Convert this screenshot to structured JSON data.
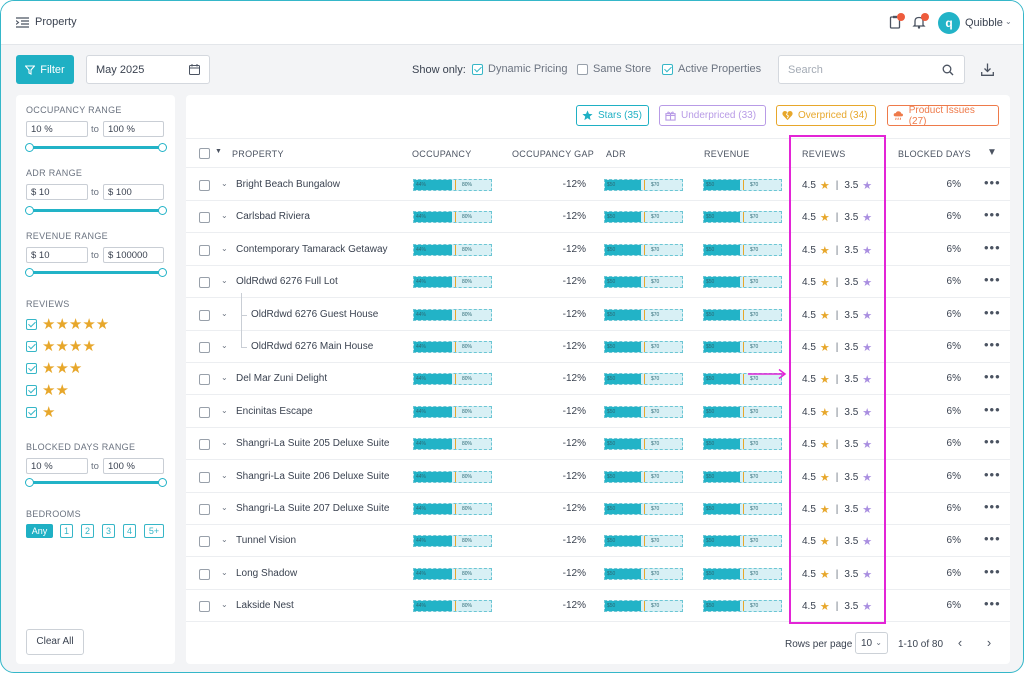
{
  "header": {
    "title": "Property",
    "user_initial": "q",
    "user_name": "Quibble",
    "icons": [
      "menu-collapse-icon",
      "clipboard-icon",
      "bell-icon",
      "chevron-down-icon"
    ]
  },
  "toolbar": {
    "filter_label": "Filter",
    "date": "May 2025",
    "show_only_label": "Show only:",
    "options": [
      {
        "label": "Dynamic Pricing",
        "checked": true
      },
      {
        "label": "Same Store",
        "checked": false
      },
      {
        "label": "Active Properties",
        "checked": true
      }
    ],
    "search_placeholder": "Search"
  },
  "sidebar": {
    "occupancy": {
      "label": "OCCUPANCY RANGE",
      "min": "10 %",
      "to": "to",
      "max": "100 %"
    },
    "adr": {
      "label": "ADR RANGE",
      "min": "$ 10",
      "to": "to",
      "max": "$ 100"
    },
    "revenue": {
      "label": "REVENUE RANGE",
      "min": "$ 10",
      "to": "to",
      "max": "$ 100000"
    },
    "reviews_label": "REVIEWS",
    "review_stars": [
      "★★★★★",
      "★★★★",
      "★★★",
      "★★",
      "★"
    ],
    "blocked": {
      "label": "BLOCKED DAYS RANGE",
      "min": "10 %",
      "to": "to",
      "max": "100 %"
    },
    "bedrooms_label": "BEDROOMS",
    "bedrooms": [
      "Any",
      "1",
      "2",
      "3",
      "4",
      "5+"
    ],
    "clear_label": "Clear All"
  },
  "chips": [
    {
      "label": "Stars (35)",
      "color": "#1fb0c4"
    },
    {
      "label": "Underpriced (33)",
      "color": "#b89be6"
    },
    {
      "label": "Overpriced (34)",
      "color": "#e7a72b"
    },
    {
      "label": "Product Issues (27)",
      "color": "#ee7a4a"
    }
  ],
  "table": {
    "headers": {
      "property": "PROPERTY",
      "occupancy": "OCCUPANCY",
      "occupancy_gap": "OCCUPANCY GAP",
      "adr": "ADR",
      "revenue": "REVENUE",
      "reviews": "REVIEWS",
      "blocked_days": "BLOCKED DAYS"
    },
    "bar_labels": {
      "occ_a": "44%",
      "occ_b": "80%",
      "money_a": "$50",
      "money_b": "$70"
    },
    "rows": [
      {
        "name": "Bright Beach Bungalow",
        "gap": "-12%",
        "r1": "4.5",
        "r2": "3.5",
        "blocked": "6%",
        "child": false
      },
      {
        "name": "Carlsbad Riviera",
        "gap": "-12%",
        "r1": "4.5",
        "r2": "3.5",
        "blocked": "6%",
        "child": false
      },
      {
        "name": "Contemporary Tamarack Getaway",
        "gap": "-12%",
        "r1": "4.5",
        "r2": "3.5",
        "blocked": "6%",
        "child": false
      },
      {
        "name": "OldRdwd 6276 Full Lot",
        "gap": "-12%",
        "r1": "4.5",
        "r2": "3.5",
        "blocked": "6%",
        "child": false
      },
      {
        "name": "OldRdwd 6276 Guest House",
        "gap": "-12%",
        "r1": "4.5",
        "r2": "3.5",
        "blocked": "6%",
        "child": true
      },
      {
        "name": "OldRdwd 6276 Main House",
        "gap": "-12%",
        "r1": "4.5",
        "r2": "3.5",
        "blocked": "6%",
        "child": true
      },
      {
        "name": "Del Mar Zuni Delight",
        "gap": "-12%",
        "r1": "4.5",
        "r2": "3.5",
        "blocked": "6%",
        "child": false
      },
      {
        "name": "Encinitas Escape",
        "gap": "-12%",
        "r1": "4.5",
        "r2": "3.5",
        "blocked": "6%",
        "child": false
      },
      {
        "name": "Shangri-La Suite  205 Deluxe Suite",
        "gap": "-12%",
        "r1": "4.5",
        "r2": "3.5",
        "blocked": "6%",
        "child": false
      },
      {
        "name": "Shangri-La Suite  206 Deluxe Suite",
        "gap": "-12%",
        "r1": "4.5",
        "r2": "3.5",
        "blocked": "6%",
        "child": false
      },
      {
        "name": "Shangri-La Suite  207 Deluxe Suite",
        "gap": "-12%",
        "r1": "4.5",
        "r2": "3.5",
        "blocked": "6%",
        "child": false
      },
      {
        "name": "Tunnel Vision",
        "gap": "-12%",
        "r1": "4.5",
        "r2": "3.5",
        "blocked": "6%",
        "child": false
      },
      {
        "name": "Long Shadow",
        "gap": "-12%",
        "r1": "4.5",
        "r2": "3.5",
        "blocked": "6%",
        "child": false
      },
      {
        "name": "Lakside Nest",
        "gap": "-12%",
        "r1": "4.5",
        "r2": "3.5",
        "blocked": "6%",
        "child": false
      }
    ]
  },
  "footer": {
    "rows_per_page_label": "Rows per page",
    "rows_per_page": "10",
    "page_info": "1-10 of 80"
  },
  "colors": {
    "accent": "#1fb0c4",
    "highlight": "#e324d6",
    "star": "#e7a72b",
    "star_alt": "#a98ee0"
  }
}
